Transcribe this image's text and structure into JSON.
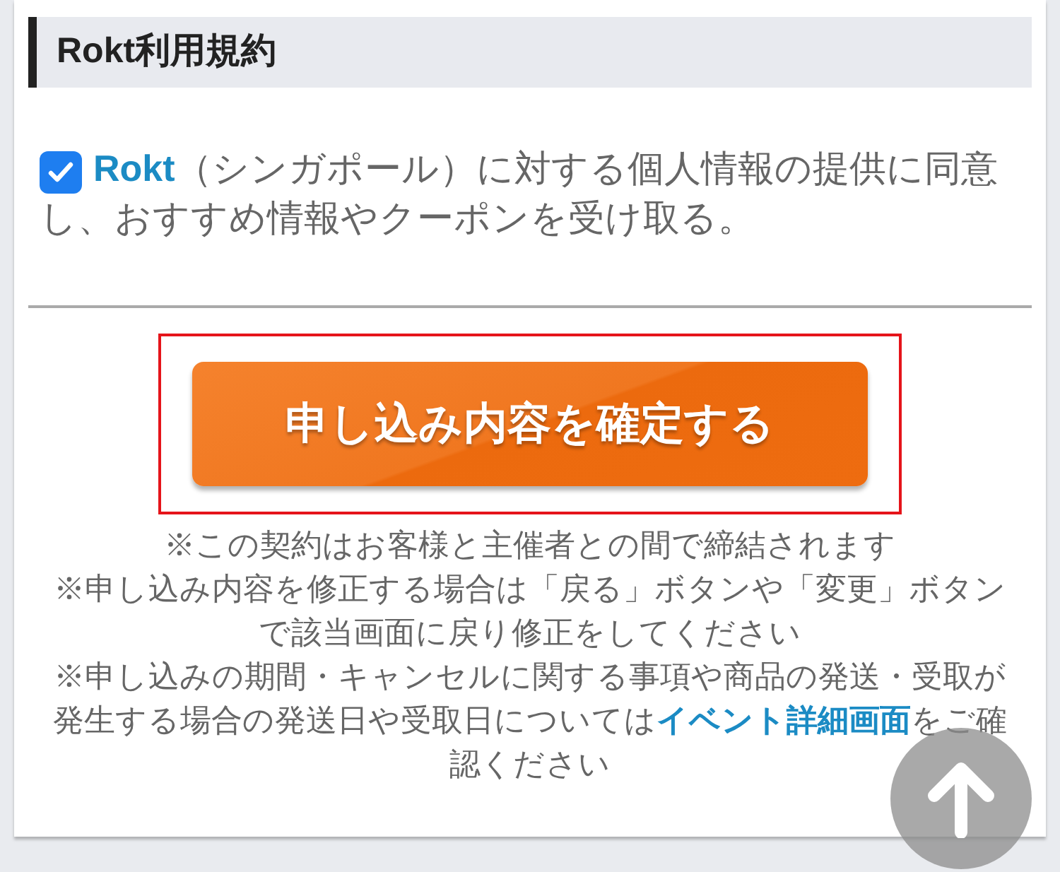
{
  "section": {
    "title": "Rokt利用規約"
  },
  "consent": {
    "checked": true,
    "brand": "Rokt",
    "text": "（シンガポール）に対する個人情報の提供に同意し、おすすめ情報やクーポンを受け取る。"
  },
  "confirm_button": {
    "label": "申し込み内容を確定する"
  },
  "notes": [
    {
      "text": "※この契約はお客様と主催者との間で締結されます"
    },
    {
      "text": "※申し込み内容を修正する場合は「戻る」ボタンや「変更」ボタンで該当画面に戻り修正をしてください"
    },
    {
      "text": "※申し込みの期間・キャンセルに関する事項や商品の発送・受取が発生する場合の発送日や受取日については",
      "link": "イベント詳細画面",
      "after": "をご確認ください"
    }
  ]
}
